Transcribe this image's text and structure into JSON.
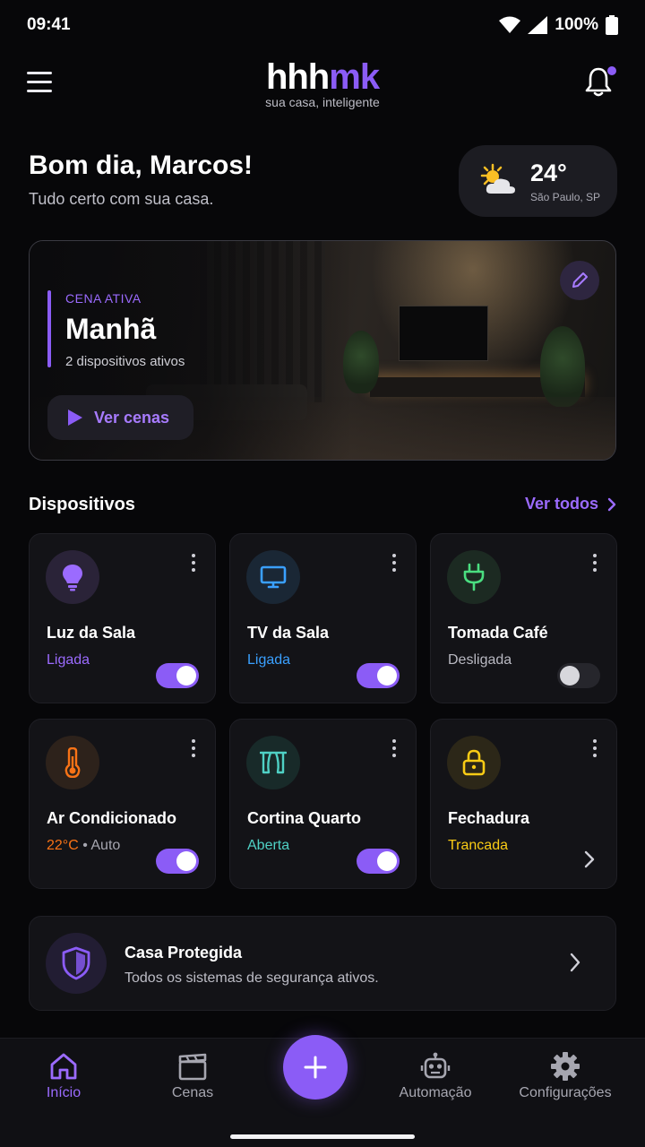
{
  "status_bar": {
    "time": "09:41",
    "battery": "100%"
  },
  "header": {
    "logo_part1": "hhh",
    "logo_part2": "mk",
    "tagline": "sua casa, inteligente"
  },
  "greeting": {
    "title": "Bom dia, Marcos!",
    "subtitle": "Tudo certo com sua casa."
  },
  "weather": {
    "temperature": "24°",
    "city": "São Paulo, SP",
    "icon": "partly-cloudy-icon"
  },
  "scene": {
    "label": "CENA ATIVA",
    "name": "Manhã",
    "devices": "2 dispositivos ativos",
    "button": "Ver cenas"
  },
  "devices_section": {
    "title": "Dispositivos",
    "link": "Ver todos"
  },
  "devices": [
    {
      "name": "Luz da Sala",
      "status": "Ligada",
      "icon": "lightbulb-icon",
      "color": "#9b6bff",
      "on": true
    },
    {
      "name": "TV da Sala",
      "status": "Ligada",
      "icon": "monitor-icon",
      "color": "#3aa0ff",
      "on": true
    },
    {
      "name": "Tomada Café",
      "status": "Desligada",
      "icon": "plug-icon",
      "color": "#4ade80",
      "on": false
    },
    {
      "name": "Ar Condicionado",
      "status": "22°C",
      "status_extra": "• Auto",
      "icon": "thermometer-icon",
      "color": "#f97316",
      "on": true
    },
    {
      "name": "Cortina Quarto",
      "status": "Aberta",
      "icon": "curtain-icon",
      "color": "#4fd1c5",
      "on": true
    },
    {
      "name": "Fechadura",
      "status": "Trancada",
      "icon": "lock-icon",
      "color": "#facc15",
      "on": null
    }
  ],
  "security": {
    "title": "Casa Protegida",
    "subtitle": "Todos os sistemas de segurança ativos."
  },
  "nav": [
    {
      "label": "Início",
      "icon": "home-icon",
      "active": true
    },
    {
      "label": "Cenas",
      "icon": "clapperboard-icon",
      "active": false
    },
    {
      "label": "Automação",
      "icon": "robot-icon",
      "active": false
    },
    {
      "label": "Configurações",
      "icon": "gear-icon",
      "active": false
    }
  ]
}
